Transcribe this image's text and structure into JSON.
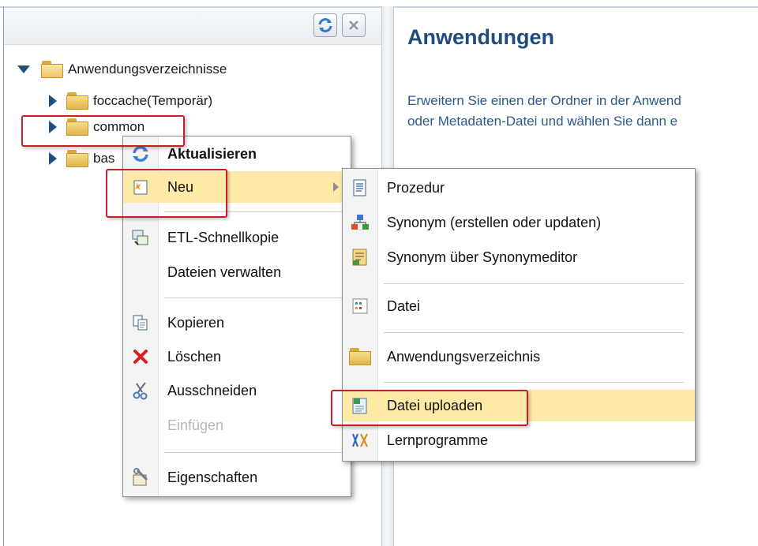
{
  "tree": {
    "root": {
      "label": "Anwendungsverzeichnisse",
      "expanded": true
    },
    "items": [
      {
        "label": "foccache(Temporär)"
      },
      {
        "label": "common"
      },
      {
        "label": "bas"
      }
    ]
  },
  "header": {
    "refresh_button": "refresh-icon",
    "close_button": "close-icon"
  },
  "content": {
    "title": "Anwendungen",
    "line1": "Erweitern Sie einen der Ordner in der Anwend",
    "line2": "oder Metadaten-Datei und wählen Sie dann e"
  },
  "context_menu": {
    "items": [
      {
        "label": "Aktualisieren",
        "icon": "refresh-icon"
      },
      {
        "label": "Neu",
        "icon": "new-icon"
      },
      {
        "label": "ETL-Schnellkopie",
        "icon": "etl-copy-icon"
      },
      {
        "label": "Dateien verwalten",
        "icon": ""
      },
      {
        "label": "Kopieren",
        "icon": "copy-icon"
      },
      {
        "label": "Löschen",
        "icon": "delete-icon"
      },
      {
        "label": "Ausschneiden",
        "icon": "scissors-icon"
      },
      {
        "label": "Einfügen",
        "icon": "",
        "disabled": true
      },
      {
        "label": "Eigenschaften",
        "icon": "properties-icon"
      }
    ]
  },
  "submenu": {
    "items": [
      {
        "label": "Prozedur",
        "icon": "document-icon"
      },
      {
        "label": "Synonym (erstellen oder updaten)",
        "icon": "synonym-icon"
      },
      {
        "label": "Synonym über Synonymeditor",
        "icon": "synonym-editor-icon"
      },
      {
        "label": "Datei",
        "icon": "file-icon"
      },
      {
        "label": "Anwendungsverzeichnis",
        "icon": "folder-icon"
      },
      {
        "label": "Datei uploaden",
        "icon": "upload-icon"
      },
      {
        "label": "Lernprogramme",
        "icon": "tutorial-icon"
      }
    ]
  },
  "colors": {
    "highlight": "#fdeaa6",
    "annotation_red": "#c81e24",
    "title_blue": "#1f4c7d"
  }
}
